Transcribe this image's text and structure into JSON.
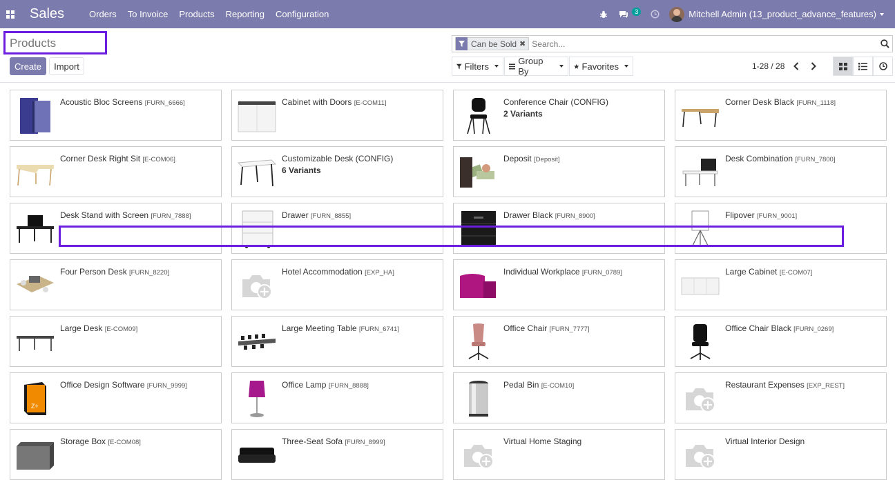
{
  "navbar": {
    "app_name": "Sales",
    "menu": [
      "Orders",
      "To Invoice",
      "Products",
      "Reporting",
      "Configuration"
    ],
    "chat_count": "3",
    "user": "Mitchell Admin (13_product_advance_features)"
  },
  "control_panel": {
    "title": "Products",
    "create_label": "Create",
    "import_label": "Import",
    "facet_label": "Can be Sold",
    "search_placeholder": "Search...",
    "filters_label": "Filters",
    "groupby_label": "Group By",
    "favorites_label": "Favorites",
    "pager": "1-28 / 28"
  },
  "products": [
    {
      "name": "Acoustic Bloc Screens",
      "code": "[FURN_6666]",
      "variants": "",
      "img": "screen"
    },
    {
      "name": "Cabinet with Doors",
      "code": "[E-COM11]",
      "variants": "",
      "img": "cabinet"
    },
    {
      "name": "Conference Chair (CONFIG)",
      "code": "",
      "variants": "2 Variants",
      "img": "chair-black"
    },
    {
      "name": "Corner Desk Black",
      "code": "[FURN_1118]",
      "variants": "",
      "img": "desk-wood"
    },
    {
      "name": "Corner Desk Right Sit",
      "code": "[E-COM06]",
      "variants": "",
      "img": "desk-light"
    },
    {
      "name": "Customizable Desk (CONFIG)",
      "code": "",
      "variants": "6 Variants",
      "img": "desk-white"
    },
    {
      "name": "Deposit",
      "code": "[Deposit]",
      "variants": "",
      "img": "money"
    },
    {
      "name": "Desk Combination",
      "code": "[FURN_7800]",
      "variants": "",
      "img": "desk-combo"
    },
    {
      "name": "Desk Stand with Screen",
      "code": "[FURN_7888]",
      "variants": "",
      "img": "desk-screen"
    },
    {
      "name": "Drawer",
      "code": "[FURN_8855]",
      "variants": "",
      "img": "drawer-white"
    },
    {
      "name": "Drawer Black",
      "code": "[FURN_8900]",
      "variants": "",
      "img": "drawer-black"
    },
    {
      "name": "Flipover",
      "code": "[FURN_9001]",
      "variants": "",
      "img": "flipover"
    },
    {
      "name": "Four Person Desk",
      "code": "[FURN_8220]",
      "variants": "",
      "img": "four-desk"
    },
    {
      "name": "Hotel Accommodation",
      "code": "[EXP_HA]",
      "variants": "",
      "img": "placeholder"
    },
    {
      "name": "Individual Workplace",
      "code": "[FURN_0789]",
      "variants": "",
      "img": "workplace"
    },
    {
      "name": "Large Cabinet",
      "code": "[E-COM07]",
      "variants": "",
      "img": "large-cabinet"
    },
    {
      "name": "Large Desk",
      "code": "[E-COM09]",
      "variants": "",
      "img": "large-desk"
    },
    {
      "name": "Large Meeting Table",
      "code": "[FURN_6741]",
      "variants": "",
      "img": "meeting-table"
    },
    {
      "name": "Office Chair",
      "code": "[FURN_7777]",
      "variants": "",
      "img": "chair-pink"
    },
    {
      "name": "Office Chair Black",
      "code": "[FURN_0269]",
      "variants": "",
      "img": "chair-office-black"
    },
    {
      "name": "Office Design Software",
      "code": "[FURN_9999]",
      "variants": "",
      "img": "software"
    },
    {
      "name": "Office Lamp",
      "code": "[FURN_8888]",
      "variants": "",
      "img": "lamp"
    },
    {
      "name": "Pedal Bin",
      "code": "[E-COM10]",
      "variants": "",
      "img": "bin"
    },
    {
      "name": "Restaurant Expenses",
      "code": "[EXP_REST]",
      "variants": "",
      "img": "placeholder"
    },
    {
      "name": "Storage Box",
      "code": "[E-COM08]",
      "variants": "",
      "img": "storage-box"
    },
    {
      "name": "Three-Seat Sofa",
      "code": "[FURN_8999]",
      "variants": "",
      "img": "sofa"
    },
    {
      "name": "Virtual Home Staging",
      "code": "",
      "variants": "",
      "img": "placeholder"
    },
    {
      "name": "Virtual Interior Design",
      "code": "",
      "variants": "",
      "img": "placeholder"
    }
  ]
}
